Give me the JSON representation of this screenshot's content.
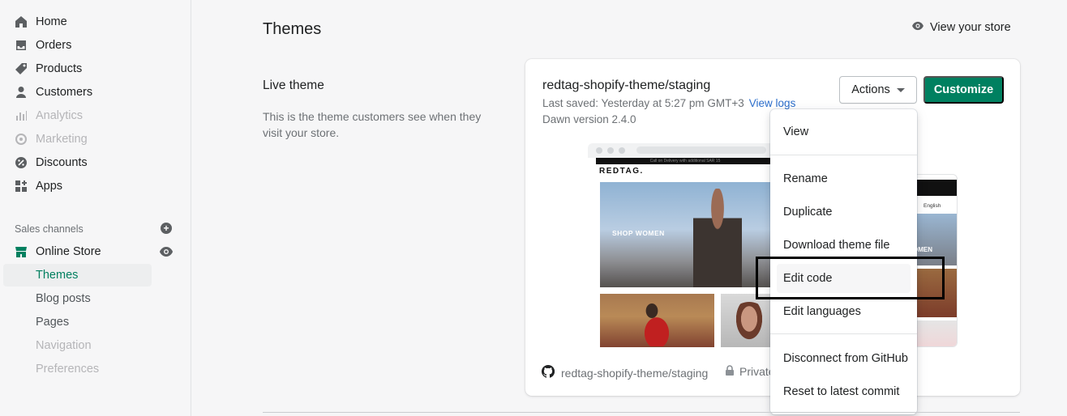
{
  "sidebar": {
    "items": [
      {
        "label": "Home",
        "icon": "home-icon"
      },
      {
        "label": "Orders",
        "icon": "orders-icon"
      },
      {
        "label": "Products",
        "icon": "tag-icon"
      },
      {
        "label": "Customers",
        "icon": "person-icon"
      },
      {
        "label": "Analytics",
        "icon": "analytics-icon"
      },
      {
        "label": "Marketing",
        "icon": "marketing-icon"
      },
      {
        "label": "Discounts",
        "icon": "discount-icon"
      },
      {
        "label": "Apps",
        "icon": "apps-icon"
      }
    ],
    "sales_channels_label": "Sales channels",
    "online_store_label": "Online Store",
    "sub_items": [
      {
        "label": "Themes"
      },
      {
        "label": "Blog posts"
      },
      {
        "label": "Pages"
      },
      {
        "label": "Navigation"
      },
      {
        "label": "Preferences"
      }
    ]
  },
  "header": {
    "title": "Themes",
    "view_store": "View your store"
  },
  "live_theme": {
    "title": "Live theme",
    "description": "This is the theme customers see when they visit your store."
  },
  "card": {
    "theme_name": "redtag-shopify-theme/staging",
    "last_saved": "Last saved: Yesterday at 5:27 pm GMT+3",
    "view_logs": "View logs",
    "dawn_version": "Dawn version 2.4.0",
    "actions_label": "Actions",
    "customize_label": "Customize",
    "repo": "redtag-shopify-theme/staging",
    "private_label": "Private"
  },
  "preview": {
    "announcement": "Call on Delivery with additional SAR 15",
    "logo": "REDTAG.",
    "hero_text": "SHOP WOMEN",
    "mobile_language": "English",
    "mobile_hero_text": "OMEN"
  },
  "dropdown": {
    "items": [
      "View",
      "Rename",
      "Duplicate",
      "Download theme file",
      "Edit code",
      "Edit languages",
      "Disconnect from GitHub",
      "Reset to latest commit"
    ]
  },
  "colors": {
    "brand_green": "#008060",
    "active_green": "#007f5f",
    "link_blue": "#2c6ecb"
  }
}
